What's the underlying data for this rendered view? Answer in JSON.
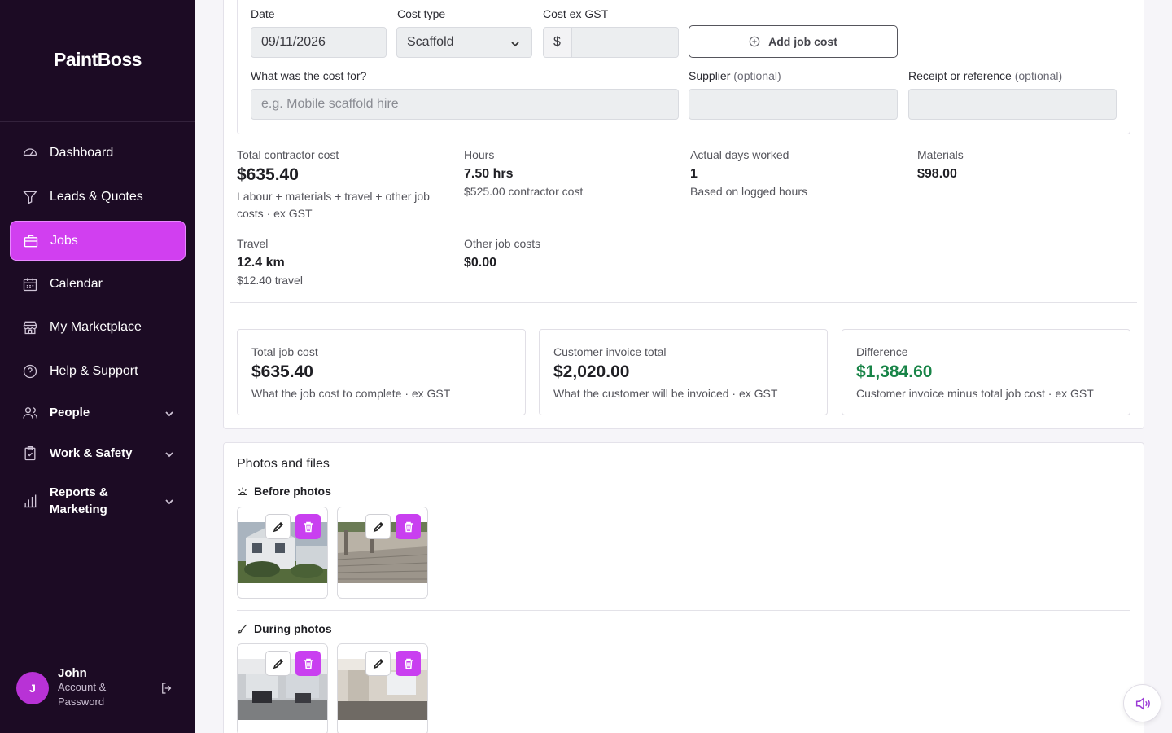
{
  "app": {
    "name": "PaintBoss"
  },
  "sidebar": {
    "items": [
      {
        "label": "Dashboard",
        "icon": "dashboard-gauge-icon"
      },
      {
        "label": "Leads & Quotes",
        "icon": "funnel-icon"
      },
      {
        "label": "Jobs",
        "icon": "briefcase-icon",
        "active": true
      },
      {
        "label": "Calendar",
        "icon": "calendar-icon"
      },
      {
        "label": "My Marketplace",
        "icon": "store-icon"
      },
      {
        "label": "Help & Support",
        "icon": "help-circle-icon"
      }
    ],
    "groups": [
      {
        "label": "People",
        "icon": "people-icon"
      },
      {
        "label": "Work & Safety",
        "icon": "clipboard-check-icon"
      },
      {
        "label": "Reports & Marketing",
        "icon": "bar-chart-icon"
      }
    ],
    "user": {
      "initial": "J",
      "name": "John",
      "sub": "Account & Password"
    }
  },
  "cost_form": {
    "date_label": "Date",
    "date_value": "09/11/2026",
    "cost_type_label": "Cost type",
    "cost_type_value": "Scaffold",
    "cost_ex_label": "Cost ex GST",
    "currency_symbol": "$",
    "cost_value": "",
    "add_button": "Add job cost",
    "cost_for_label": "What was the cost for?",
    "cost_for_placeholder": "e.g. Mobile scaffold hire",
    "supplier_label": "Supplier",
    "receipt_label": "Receipt or reference",
    "optional": "(optional)"
  },
  "stats": {
    "total_contractor_cost": {
      "label": "Total contractor cost",
      "value": "$635.40",
      "sub": "Labour + materials + travel + other job costs · ex GST"
    },
    "hours": {
      "label": "Hours",
      "value": "7.50 hrs",
      "sub": "$525.00 contractor cost"
    },
    "days": {
      "label": "Actual days worked",
      "value": "1",
      "sub": "Based on logged hours"
    },
    "materials": {
      "label": "Materials",
      "value": "$98.00"
    },
    "travel": {
      "label": "Travel",
      "value": "12.4 km",
      "sub": "$12.40 travel"
    },
    "other": {
      "label": "Other job costs",
      "value": "$0.00"
    }
  },
  "summary": [
    {
      "label": "Total job cost",
      "value": "$635.40",
      "sub": "What the job cost to complete · ex GST"
    },
    {
      "label": "Customer invoice total",
      "value": "$2,020.00",
      "sub": "What the customer will be invoiced · ex GST"
    },
    {
      "label": "Difference",
      "value": "$1,384.60",
      "sub": "Customer invoice minus total job cost · ex GST",
      "color": "#188447"
    }
  ],
  "photos": {
    "title": "Photos and files",
    "before_label": "Before photos",
    "during_label": "During photos"
  },
  "colors": {
    "accent": "#d13ff0",
    "sidebar_bg": "#1c0b24",
    "positive": "#188447"
  }
}
